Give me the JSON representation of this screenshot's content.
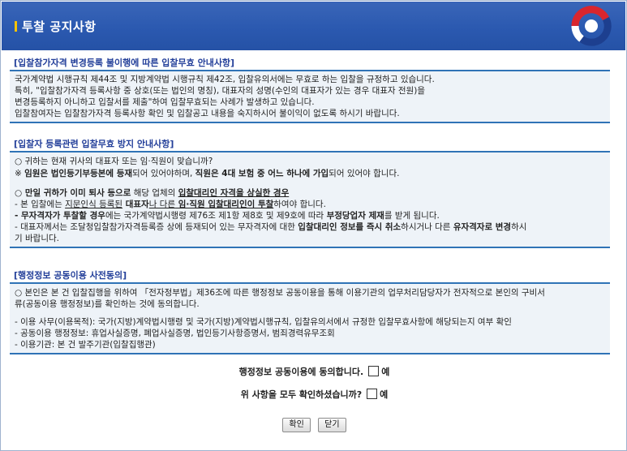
{
  "window": {
    "title": "투찰 공지사항"
  },
  "section1": {
    "heading": "[입찰참가자격 변경등록 불이행에 따른 입찰무효 안내사항]",
    "lines": [
      "국가계약법 시행규칙 제44조 및 지방계약법 시행규칙 제42조, 입찰유의서에는 무효로 하는 입찰을 규정하고 있습니다.",
      "특히, \"입찰참가자격 등록사항 중 상호(또는 법인의 명칭), 대표자의 성명(수인의 대표자가 있는 경우 대표자 전원)을",
      "변경등록하지 아니하고 입찰서를 제출\"하여 입찰무효되는 사례가 발생하고 있습니다.",
      "입찰참여자는 입찰참가자격 등록사항 확인 및 입찰공고 내용을 숙지하시어 불이익이 없도록 하시기 바랍니다."
    ]
  },
  "section2": {
    "heading": "[입찰자 등록관련 입찰무효 방지 안내사항]",
    "q1": "○ 귀하는 현재 귀사의 대표자 또는 임·직원이 맞습니까?",
    "q2_pre": "※ ",
    "q2_b1": "임원은 법인등기부등본에 등재",
    "q2_t1": "되어 있어야하며, ",
    "q2_b2": "직원은 4대 보험 중 어느 하나에 가입",
    "q2_t2": "되어 있어야 합니다.",
    "case_b1": "○ 만일 귀하가 이미 퇴사 등으로",
    "case_t1": " 해당 업체의 ",
    "case_b2": "입찰대리인 자격을 상실한 경우",
    "l1_t1": "- 본 입찰에는 ",
    "l1_u1": "지문인식 등록된",
    "l1_b1": " 대표자",
    "l1_u2": "나 다른",
    "l1_b2": " 임·직원 입찰대리인이 투찰",
    "l1_t2": "하여야 합니다.",
    "l2_b1": "- 무자격자가 투찰할 경우",
    "l2_t1": "에는 국가계약법시행령 제76조 제1항 제8호 및 제9호에 따라 ",
    "l2_b2": "부정당업자 제재",
    "l2_t2": "를 받게 됩니다.",
    "l3_t1": "- 대표자께서는 조달청입찰참가자격등록증 상에 등재되어 있는 무자격자에 대한 ",
    "l3_b1": "입찰대리인 정보를 즉시 취소",
    "l3_t2": "하시거나 다른 ",
    "l3_b2": "유자격자로 변경",
    "l3_t3": "하시",
    "l3_cont": "기 바랍니다."
  },
  "section3": {
    "heading": "[행정정보 공동이용 사전동의]",
    "intro1": "○ 본인은 본 건 입찰집행을 위하여 「전자정부법」제36조에 따른 행정정보 공동이용을 통해 이용기관의 업무처리담당자가 전자적으로 본인의 구비서",
    "intro2": "류(공동이용 행정정보)를 확인하는 것에 동의합니다.",
    "items": [
      "- 이용 사무(이용목적): 국가(지방)계약법시행령 및 국가(지방)계약법시행규칙, 입찰유의서에서 규정한 입찰무효사항에 해당되는지 여부 확인",
      "- 공동이용 행정정보: 휴업사실증명, 폐업사실증명, 법인등기사항증명서, 범죄경력유무조회",
      "- 이용기관: 본 건 발주기관(입찰집행관)"
    ]
  },
  "confirm": {
    "agree_label": "행정정보 공동이용에 동의합니다.",
    "agree_option": "예",
    "check_label": "위 사항을 모두 확인하셨습니까?",
    "check_option": "예"
  },
  "buttons": {
    "ok": "확인",
    "close": "닫기"
  },
  "colors": {
    "title_bar": "#2b59b0",
    "heading_text": "#223e99",
    "section_border": "#2f73b6",
    "section_bg": "#eef3f8",
    "title_mark": "#f5c200"
  }
}
